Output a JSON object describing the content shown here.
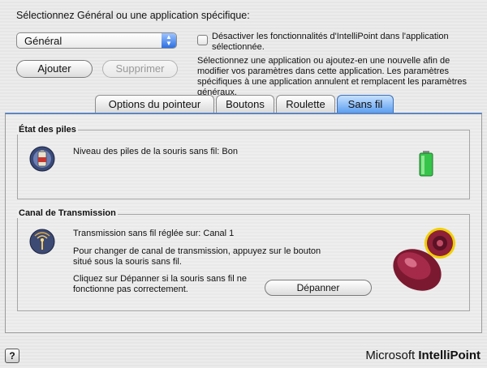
{
  "header": {
    "label": "Sélectionnez Général ou une application spécifique:"
  },
  "app_select": {
    "value": "Général"
  },
  "buttons": {
    "add": "Ajouter",
    "remove": "Supprimer",
    "troubleshoot": "Dépanner"
  },
  "disable_option": {
    "label": "Désactiver les fonctionnalités d'IntelliPoint dans l'application sélectionnée."
  },
  "info_text": "Sélectionnez une application ou ajoutez-en une nouvelle afin de modifier vos paramètres dans cette application. Les paramètres spécifiques à une application annulent et remplacent les paramètres généraux.",
  "tabs": [
    {
      "label": "Options du pointeur"
    },
    {
      "label": "Boutons"
    },
    {
      "label": "Roulette"
    },
    {
      "label": "Sans fil"
    }
  ],
  "battery": {
    "title": "État des piles",
    "status": "Niveau des piles de la souris sans fil: Bon"
  },
  "channel": {
    "title": "Canal de Transmission",
    "setting": "Transmission sans fil réglée sur: Canal 1",
    "instruction": "Pour changer de canal de transmission, appuyez sur le bouton situé sous la souris sans fil.",
    "troubleshoot_hint": "Cliquez sur Dépanner si la souris sans fil ne fonctionne pas correctement."
  },
  "footer": {
    "help": "?",
    "brand_regular": "Microsoft ",
    "brand_bold": "IntelliPoint"
  },
  "colors": {
    "accent": "#5e9ff0",
    "battery": "#2fbf3a",
    "mouse": "#8b1e3a"
  }
}
